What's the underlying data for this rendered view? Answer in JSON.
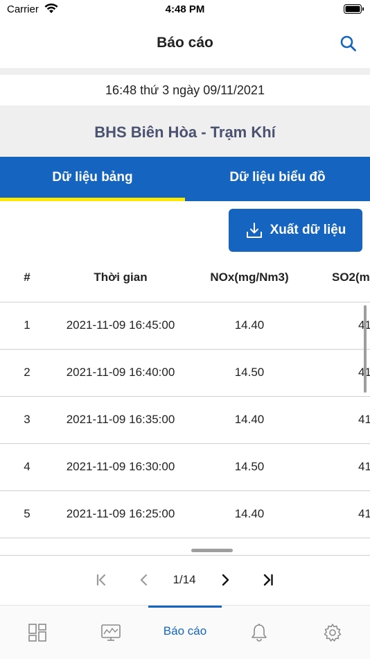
{
  "status_bar": {
    "carrier": "Carrier",
    "time": "4:48 PM"
  },
  "nav": {
    "title": "Báo cáo",
    "search_icon": "search-icon"
  },
  "report": {
    "datetime": "16:48 thứ 3 ngày 09/11/2021",
    "station": "BHS Biên Hòa - Trạm Khí"
  },
  "tabs": [
    {
      "label": "Dữ liệu bảng",
      "active": true
    },
    {
      "label": "Dữ liệu biểu đồ",
      "active": false
    }
  ],
  "export": {
    "label": "Xuất dữ liệu",
    "icon": "download-icon"
  },
  "table": {
    "headers": {
      "index": "#",
      "time": "Thời gian",
      "nox": "NOx(mg/Nm3)",
      "so2": "SO2(m"
    },
    "rows": [
      {
        "index": "1",
        "time": "2021-11-09 16:45:00",
        "nox": "14.40",
        "so2": "41"
      },
      {
        "index": "2",
        "time": "2021-11-09 16:40:00",
        "nox": "14.50",
        "so2": "41"
      },
      {
        "index": "3",
        "time": "2021-11-09 16:35:00",
        "nox": "14.40",
        "so2": "41"
      },
      {
        "index": "4",
        "time": "2021-11-09 16:30:00",
        "nox": "14.50",
        "so2": "41"
      },
      {
        "index": "5",
        "time": "2021-11-09 16:25:00",
        "nox": "14.40",
        "so2": "41"
      }
    ]
  },
  "pagination": {
    "label": "1/14"
  },
  "bottom_nav": {
    "items": [
      {
        "icon": "dashboard-icon"
      },
      {
        "icon": "monitor-chart-icon"
      },
      {
        "label": "Báo cáo",
        "active": true
      },
      {
        "icon": "bell-icon"
      },
      {
        "icon": "gear-icon"
      }
    ]
  },
  "colors": {
    "primary": "#1565c0",
    "tab_indicator": "#ffe900",
    "station_text": "#4a5270",
    "band_gray": "#efefef"
  }
}
